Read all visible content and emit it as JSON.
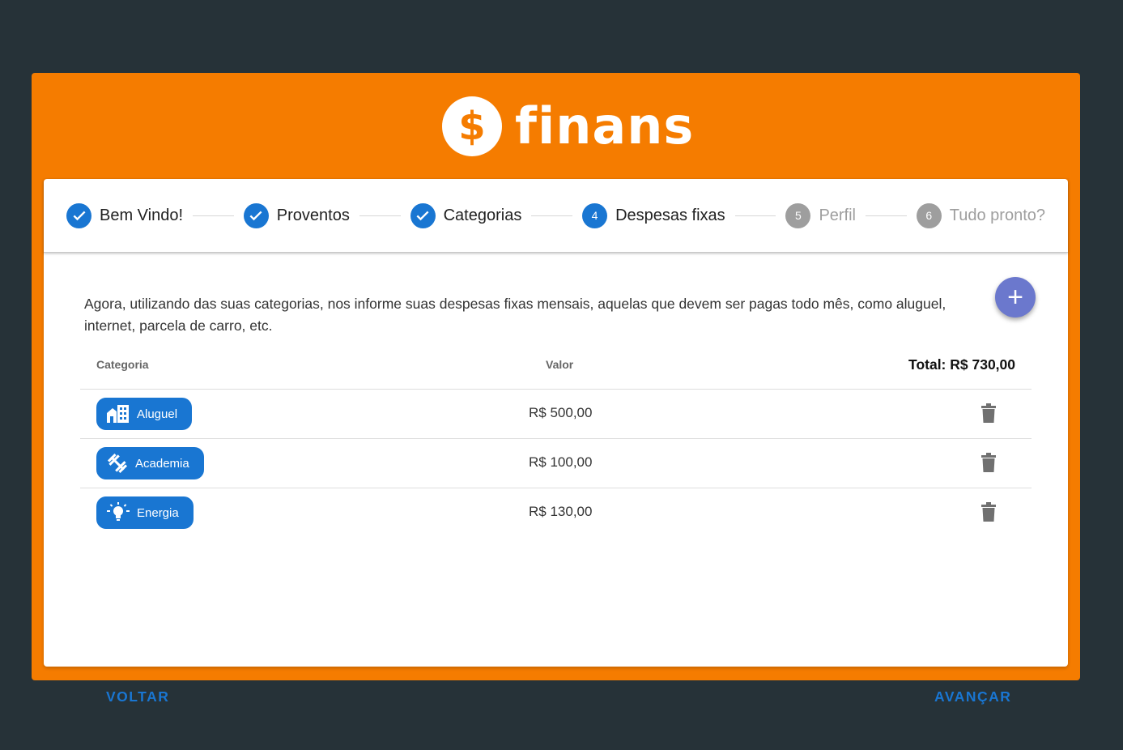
{
  "app": {
    "name": "finans",
    "logo_symbol": "$",
    "accent": "#f57c00",
    "primary": "#1976d2"
  },
  "steps": [
    {
      "label": "Bem Vindo!",
      "state": "done"
    },
    {
      "label": "Proventos",
      "state": "done"
    },
    {
      "label": "Categorias",
      "state": "done"
    },
    {
      "label": "Despesas fixas",
      "state": "active",
      "number": "4"
    },
    {
      "label": "Perfil",
      "state": "future",
      "number": "5"
    },
    {
      "label": "Tudo pronto?",
      "state": "future",
      "number": "6"
    }
  ],
  "intro_text": "Agora, utilizando das suas categorias, nos informe suas despesas fixas mensais, aquelas que devem ser pagas todo mês, como aluguel, internet, parcela de carro, etc.",
  "add_button": {
    "icon": "plus-icon",
    "symbol": "+"
  },
  "table": {
    "headers": {
      "category": "Categoria",
      "value": "Valor",
      "total": "Total: R$ 730,00"
    },
    "rows": [
      {
        "category": "Aluguel",
        "icon": "building-icon",
        "value": "R$ 500,00"
      },
      {
        "category": "Academia",
        "icon": "dumbbell-icon",
        "value": "R$ 100,00"
      },
      {
        "category": "Energia",
        "icon": "lightbulb-icon",
        "value": "R$ 130,00"
      }
    ]
  },
  "actions": {
    "back": "VOLTAR",
    "next": "AVANÇAR"
  }
}
